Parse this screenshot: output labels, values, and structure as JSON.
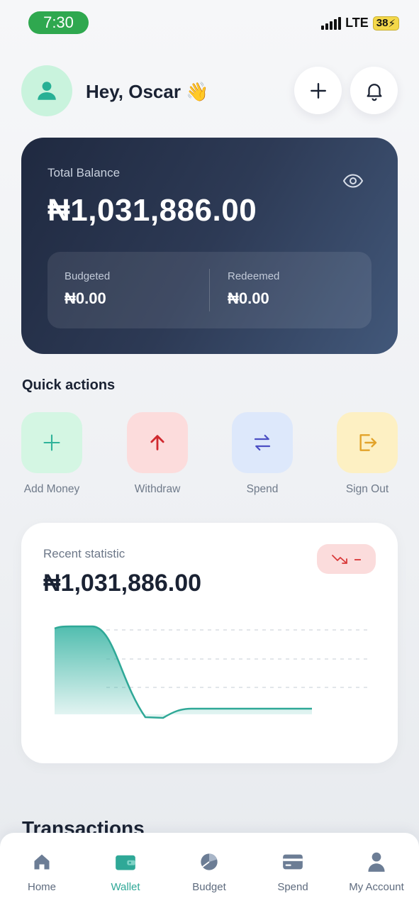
{
  "status_bar": {
    "time": "7:30",
    "network": "LTE",
    "battery": "38"
  },
  "header": {
    "greeting": "Hey, Oscar 👋"
  },
  "balance_card": {
    "label": "Total Balance",
    "amount": "₦1,031,886.00",
    "budgeted_label": "Budgeted",
    "budgeted_value": "₦0.00",
    "redeemed_label": "Redeemed",
    "redeemed_value": "₦0.00"
  },
  "quick_actions": {
    "title": "Quick actions",
    "items": [
      {
        "label": "Add Money",
        "icon": "plus-icon",
        "bg": "#d4f6e3",
        "color": "#2fb39a"
      },
      {
        "label": "Withdraw",
        "icon": "arrow-up-icon",
        "bg": "#fcdcdc",
        "color": "#d0292f"
      },
      {
        "label": "Spend",
        "icon": "swap-icon",
        "bg": "#dde8fb",
        "color": "#4c4fc4"
      },
      {
        "label": "Sign Out",
        "icon": "sign-out-icon",
        "bg": "#fdf0c3",
        "color": "#e2a32a"
      }
    ]
  },
  "statistic": {
    "label": "Recent statistic",
    "amount": "₦1,031,886.00",
    "trend_change": "–",
    "trend_color": "#d93a3a"
  },
  "transactions": {
    "title": "Transactions"
  },
  "bottom_nav": {
    "items": [
      {
        "label": "Home",
        "icon": "home-icon",
        "active": false
      },
      {
        "label": "Wallet",
        "icon": "wallet-icon",
        "active": true
      },
      {
        "label": "Budget",
        "icon": "pie-chart-icon",
        "active": false
      },
      {
        "label": "Spend",
        "icon": "card-icon",
        "active": false
      },
      {
        "label": "My Account",
        "icon": "user-icon",
        "active": false
      }
    ]
  },
  "colors": {
    "accent": "#2fa897",
    "card_dark": "#2d3a55",
    "time_pill": "#2fa84f"
  }
}
